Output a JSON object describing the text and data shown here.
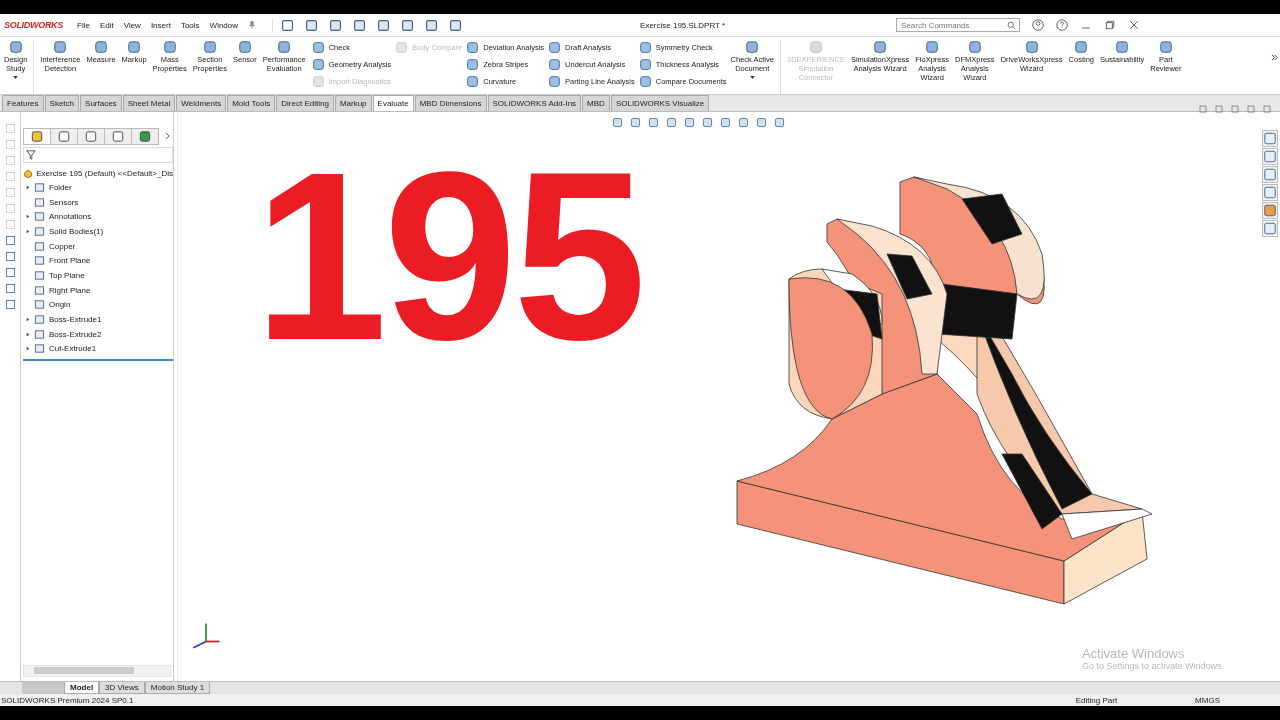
{
  "title_bar": {
    "logo": "SOLIDWORKS",
    "menus": [
      "File",
      "Edit",
      "View",
      "Insert",
      "Tools",
      "Window"
    ],
    "document_title": "Exercise 195.SLDPRT *",
    "search": {
      "placeholder": "Search Commands"
    }
  },
  "ribbon": [
    {
      "kind": "large",
      "label": "Design\nStudy",
      "disabled": false,
      "dropdown": true
    },
    {
      "kind": "large",
      "label": "Interference\nDetection",
      "disabled": false,
      "dropdown": false
    },
    {
      "kind": "large",
      "label": "Measure",
      "disabled": false,
      "dropdown": false
    },
    {
      "kind": "large",
      "label": "Markup",
      "disabled": false,
      "dropdown": false
    },
    {
      "kind": "large",
      "label": "Mass\nProperties",
      "disabled": false,
      "dropdown": false
    },
    {
      "kind": "large",
      "label": "Section\nProperties",
      "disabled": false,
      "dropdown": false
    },
    {
      "kind": "large",
      "label": "Sensor",
      "disabled": false,
      "dropdown": false
    },
    {
      "kind": "large",
      "label": "Performance\nEvaluation",
      "disabled": false,
      "dropdown": false
    },
    {
      "kind": "stack",
      "items": [
        {
          "label": "Check",
          "disabled": false
        },
        {
          "label": "Geometry Analysis",
          "disabled": false
        },
        {
          "label": "Import Diagnostics",
          "disabled": true
        }
      ]
    },
    {
      "kind": "stack",
      "items": [
        {
          "label": "Body Compare",
          "disabled": true
        }
      ]
    },
    {
      "kind": "stack",
      "items": [
        {
          "label": "Deviation Analysis",
          "disabled": false
        },
        {
          "label": "Zebra Stripes",
          "disabled": false
        },
        {
          "label": "Curvature",
          "disabled": false
        }
      ]
    },
    {
      "kind": "stack",
      "items": [
        {
          "label": "Draft Analysis",
          "disabled": false
        },
        {
          "label": "Undercut Analysis",
          "disabled": false
        },
        {
          "label": "Parting Line Analysis",
          "disabled": false
        }
      ]
    },
    {
      "kind": "stack",
      "items": [
        {
          "label": "Symmetry Check",
          "disabled": false
        },
        {
          "label": "Thickness Analysis",
          "disabled": false
        },
        {
          "label": "Compare Documents",
          "disabled": false
        }
      ]
    },
    {
      "kind": "large",
      "label": "Check Active\nDocument",
      "disabled": false,
      "dropdown": true
    },
    {
      "kind": "large",
      "label": "3DEXPERIENCE\nSimulation\nConnector",
      "disabled": true,
      "dropdown": false
    },
    {
      "kind": "large",
      "label": "SimulationXpress\nAnalysis Wizard",
      "disabled": false,
      "dropdown": false
    },
    {
      "kind": "large",
      "label": "FloXpress\nAnalysis\nWizard",
      "disabled": false,
      "dropdown": false
    },
    {
      "kind": "large",
      "label": "DFMXpress\nAnalysis\nWizard",
      "disabled": false,
      "dropdown": false
    },
    {
      "kind": "large",
      "label": "DriveWorksXpress\nWizard",
      "disabled": false,
      "dropdown": false
    },
    {
      "kind": "large",
      "label": "Costing",
      "disabled": false,
      "dropdown": false
    },
    {
      "kind": "large",
      "label": "Sustainability",
      "disabled": false,
      "dropdown": false
    },
    {
      "kind": "large",
      "label": "Part\nReviewer",
      "disabled": false,
      "dropdown": false
    }
  ],
  "tabs": [
    {
      "label": "Features",
      "selected": false
    },
    {
      "label": "Sketch",
      "selected": false
    },
    {
      "label": "Surfaces",
      "selected": false
    },
    {
      "label": "Sheet Metal",
      "selected": false
    },
    {
      "label": "Weldments",
      "selected": false
    },
    {
      "label": "Mold Tools",
      "selected": false
    },
    {
      "label": "Direct Editing",
      "selected": false
    },
    {
      "label": "Markup",
      "selected": false
    },
    {
      "label": "Evaluate",
      "selected": true
    },
    {
      "label": "MBD Dimensions",
      "selected": false
    },
    {
      "label": "SOLIDWORKS Add-Ins",
      "selected": false
    },
    {
      "label": "MBD",
      "selected": false
    },
    {
      "label": "SOLIDWORKS Visualize",
      "selected": false
    }
  ],
  "feature_tree": {
    "root": "Exercise 195 (Default) <<Default>_Dis",
    "items": [
      {
        "label": "Folder",
        "expander": true
      },
      {
        "label": "Sensors",
        "expander": false
      },
      {
        "label": "Annotations",
        "expander": true
      },
      {
        "label": "Solid Bodies(1)",
        "expander": true
      },
      {
        "label": "Copper",
        "expander": false
      },
      {
        "label": "Front Plane",
        "expander": false
      },
      {
        "label": "Top Plane",
        "expander": false
      },
      {
        "label": "Right Plane",
        "expander": false
      },
      {
        "label": "Origin",
        "expander": false
      },
      {
        "label": "Boss-Extrude1",
        "expander": true
      },
      {
        "label": "Boss-Extrude2",
        "expander": true
      },
      {
        "label": "Cut-Extrude1",
        "expander": true
      }
    ]
  },
  "viewport": {
    "overlay_text": "195",
    "activation_notice": {
      "title": "Activate Windows",
      "detail": "Go to Settings to activate Windows."
    }
  },
  "bottom_tabs": [
    {
      "label": "Model",
      "selected": true
    },
    {
      "label": "3D Views",
      "selected": false
    },
    {
      "label": "Motion Study 1",
      "selected": false
    }
  ],
  "status_bar": {
    "product": "SOLIDWORKS Premium 2024 SP0.1",
    "mode": "Editing Part",
    "units": "MMGS"
  }
}
